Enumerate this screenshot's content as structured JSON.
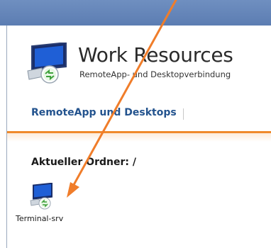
{
  "header": {
    "title": "Work Resources",
    "subtitle": "RemoteApp- und Desktopverbindung"
  },
  "nav": {
    "tab_label": "RemoteApp und Desktops"
  },
  "content": {
    "folder_label": "Aktueller Ordner: /",
    "items": [
      {
        "label": "Terminal-srv",
        "icon": "remote-desktop-icon"
      }
    ]
  },
  "colors": {
    "topbar": "#6f8fc0",
    "tab_text": "#23538e",
    "accent_line": "#f08a2c",
    "arrow": "#f07d2a"
  }
}
